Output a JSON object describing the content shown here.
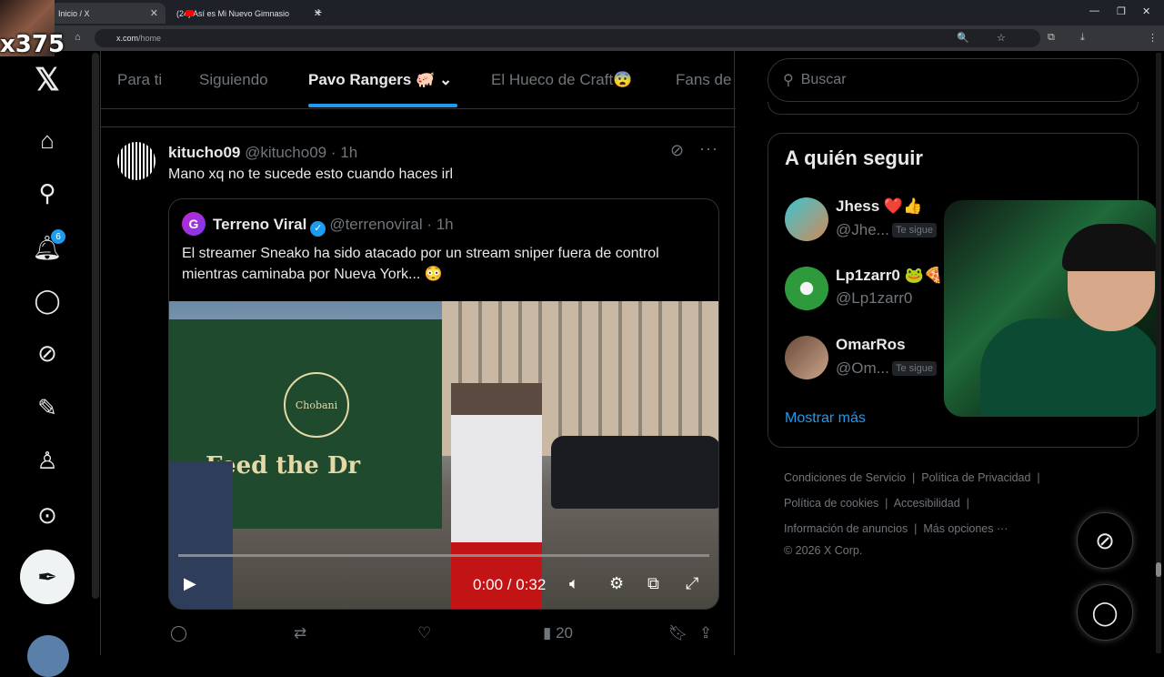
{
  "browser": {
    "tabs": [
      {
        "label": "Inicio / X"
      },
      {
        "label": "(24) Así es Mi Nuevo Gimnasio"
      }
    ],
    "url_host": "x.com",
    "url_path": "/home"
  },
  "overlay": {
    "counter": "x375"
  },
  "nav": {
    "notifications_badge": "6"
  },
  "timeline_tabs": [
    {
      "label": "Para ti"
    },
    {
      "label": "Siguiendo"
    },
    {
      "label": "Pavo Rangers 🐖"
    },
    {
      "label": "El Hueco de Craft😨"
    },
    {
      "label": "Fans de"
    }
  ],
  "tweet": {
    "name": "kitucho09",
    "handle": "@kitucho09",
    "time": "· 1h",
    "text": "Mano xq no te sucede esto cuando haces irl",
    "quote": {
      "avatar_letter": "G",
      "name": "Terreno Viral",
      "handle": "@terrenoviral",
      "time": "· 1h",
      "text": "El streamer Sneako ha sido atacado por un stream sniper fuera de control mientras caminaba por Nueva York... 😳",
      "video": {
        "time": "0:00 / 0:32",
        "banner_text": "Feed the Dr",
        "logo_text": "Chobani"
      }
    },
    "views": "20"
  },
  "sidebar": {
    "search_placeholder": "Buscar",
    "who_to_follow_title": "A quién seguir",
    "accounts": [
      {
        "name": "Jhess ❤️👍",
        "handle": "@Jhe...",
        "follows_you": "Te sigue"
      },
      {
        "name": "Lp1zarr0 🐸🍕",
        "handle": "@Lp1zarr0",
        "follows_you": ""
      },
      {
        "name": "OmarRos",
        "handle": "@Om...",
        "follows_you": "Te sigue"
      }
    ],
    "show_more": "Mostrar más",
    "footer_links": [
      "Condiciones de Servicio",
      "Política de Privacidad",
      "Política de cookies",
      "Accesibilidad",
      "Información de anuncios",
      "Más opciones ···"
    ],
    "copyright": "© 2026 X Corp."
  }
}
